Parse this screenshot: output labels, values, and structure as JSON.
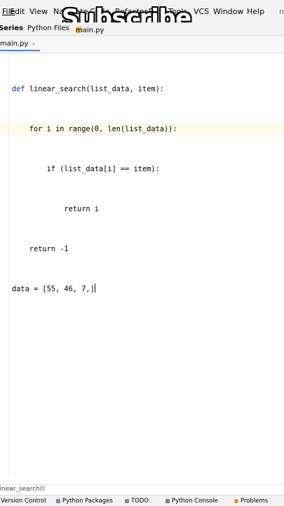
{
  "menu": {
    "items": [
      "File",
      "Edit",
      "View",
      "Navigate",
      "Code",
      "Refactor",
      "Run",
      "Tools",
      "VCS",
      "Window",
      "Help"
    ],
    "overflow": "n"
  },
  "overlay": {
    "text": "Subscribe"
  },
  "breadcrumb": {
    "project": "Series",
    "folder": "Python Files",
    "file": "main.py"
  },
  "tabs": [
    {
      "label": "main.py",
      "close": "×"
    }
  ],
  "code": {
    "lines": [
      "def linear_search(list_data, item):",
      "    for i in range(0, len(list_data)):",
      "        if (list_data[i] == item):",
      "            return i",
      "    return -1",
      "data = [55, 46, 7,]"
    ]
  },
  "status": {
    "breadcrumb": "linear_search()"
  },
  "bottom_tabs": [
    {
      "label": "Version Control",
      "icon": "branch-icon"
    },
    {
      "label": "Python Packages",
      "icon": "package-icon"
    },
    {
      "label": "TODO",
      "icon": "todo-icon"
    },
    {
      "label": "Python Console",
      "icon": "console-icon"
    },
    {
      "label": "Problems",
      "icon": "problems-icon"
    }
  ],
  "colors": {
    "keyword": "#0033b3",
    "number": "#1750eb",
    "tab_underline": "#4a88c7"
  }
}
